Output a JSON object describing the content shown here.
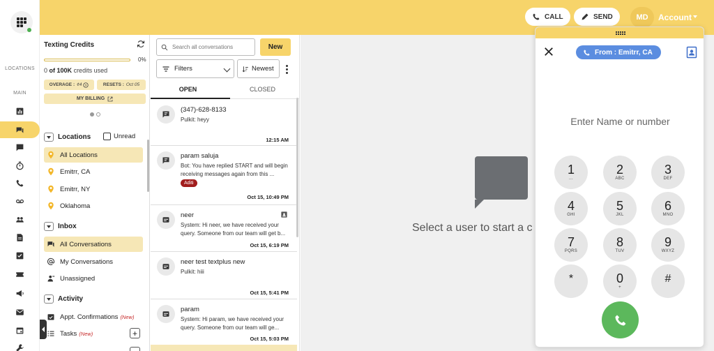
{
  "header": {
    "call_label": "CALL",
    "send_label": "SEND",
    "avatar_initials": "MD",
    "account_label": "Account",
    "color": "#f7d46a"
  },
  "rail": {
    "locations_label": "LOCATIONS",
    "main_label": "MAIN",
    "icons": [
      "dashboard-icon",
      "chat-icon",
      "message-icon",
      "timer-icon",
      "phone-icon",
      "voicemail-icon",
      "people-icon",
      "document-icon",
      "checklist-icon",
      "ticket-icon",
      "megaphone-icon",
      "mail-icon",
      "calendar-icon",
      "wrench-icon"
    ]
  },
  "credits": {
    "title": "Texting Credits",
    "percent_label": "0%",
    "progress": 0.0,
    "used_prefix": "0",
    "used_total": "of 100K",
    "used_suffix": "credits used",
    "overage_label": "OVERAGE :",
    "overage_value": "¢4",
    "resets_label": "RESETS :",
    "resets_value": "Oct 05",
    "billing_label": "MY BILLING"
  },
  "locations": {
    "header": "Locations",
    "unread_label": "Unread",
    "items": [
      {
        "label": "All Locations"
      },
      {
        "label": "Emitrr, CA"
      },
      {
        "label": "Emitrr, NY"
      },
      {
        "label": "Oklahoma"
      }
    ]
  },
  "inbox": {
    "header": "Inbox",
    "items": [
      {
        "label": "All Conversations"
      },
      {
        "label": "My Conversations"
      },
      {
        "label": "Unassigned"
      }
    ]
  },
  "activity": {
    "header": "Activity",
    "items": [
      {
        "label": "Appt. Confirmations",
        "tag": "(New)"
      },
      {
        "label": "Tasks",
        "tag": "(New)"
      }
    ]
  },
  "conversations": {
    "search_placeholder": "Search all conversations",
    "new_label": "New",
    "filters_label": "Filters",
    "sort_label": "Newest",
    "tab_open": "OPEN",
    "tab_closed": "CLOSED",
    "items": [
      {
        "name": "(347)-628-8133",
        "message": "Pulkit: heyy",
        "time": "12:15 AM"
      },
      {
        "name": "param saluja",
        "message": "Bot: You have replied START and will begin receiving messages again from this ...",
        "badge": "Aditi",
        "time": "Oct 15, 10:49 PM"
      },
      {
        "name": "neer",
        "message": "System: Hi neer, we have received your query. Someone from our team will get b...",
        "time": "Oct 15, 6:19 PM"
      },
      {
        "name": "neer test textplus new",
        "message": "Pulkit: hiii",
        "time": "Oct 15, 5:41 PM"
      },
      {
        "name": "param",
        "message": "System: Hi param, we have received your query. Someone from our team will ge...",
        "time": "Oct 15, 5:03 PM"
      }
    ]
  },
  "main": {
    "empty_text": "Select a user to start a c"
  },
  "dialer": {
    "from_label": "From : Emitrr, CA",
    "input_placeholder": "Enter Name or number",
    "keys": [
      {
        "digit": "1",
        "letters": "..."
      },
      {
        "digit": "2",
        "letters": "ABC"
      },
      {
        "digit": "3",
        "letters": "DEF"
      },
      {
        "digit": "4",
        "letters": "GHI"
      },
      {
        "digit": "5",
        "letters": "JKL"
      },
      {
        "digit": "6",
        "letters": "MNO"
      },
      {
        "digit": "7",
        "letters": "PQRS"
      },
      {
        "digit": "8",
        "letters": "TUV"
      },
      {
        "digit": "9",
        "letters": "WXYZ"
      },
      {
        "digit": "*",
        "letters": ""
      },
      {
        "digit": "0",
        "letters": "+"
      },
      {
        "digit": "#",
        "letters": ""
      }
    ],
    "call_color": "#5cb85c",
    "pill_color": "#5b8de0"
  }
}
